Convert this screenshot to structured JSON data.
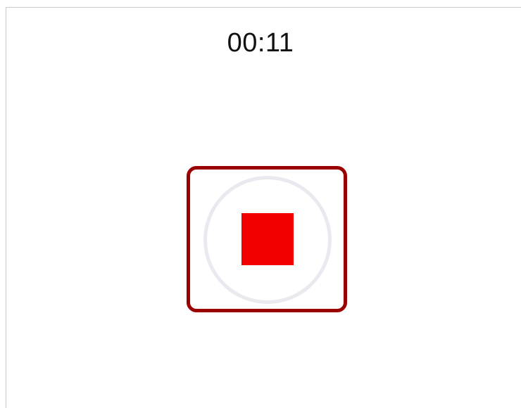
{
  "recorder": {
    "elapsed_time": "00:11"
  },
  "stop_button": {
    "icon": "stop-icon",
    "highlight_color": "#9b0000",
    "ring_color": "#e9eaef",
    "icon_color": "#f20000"
  }
}
